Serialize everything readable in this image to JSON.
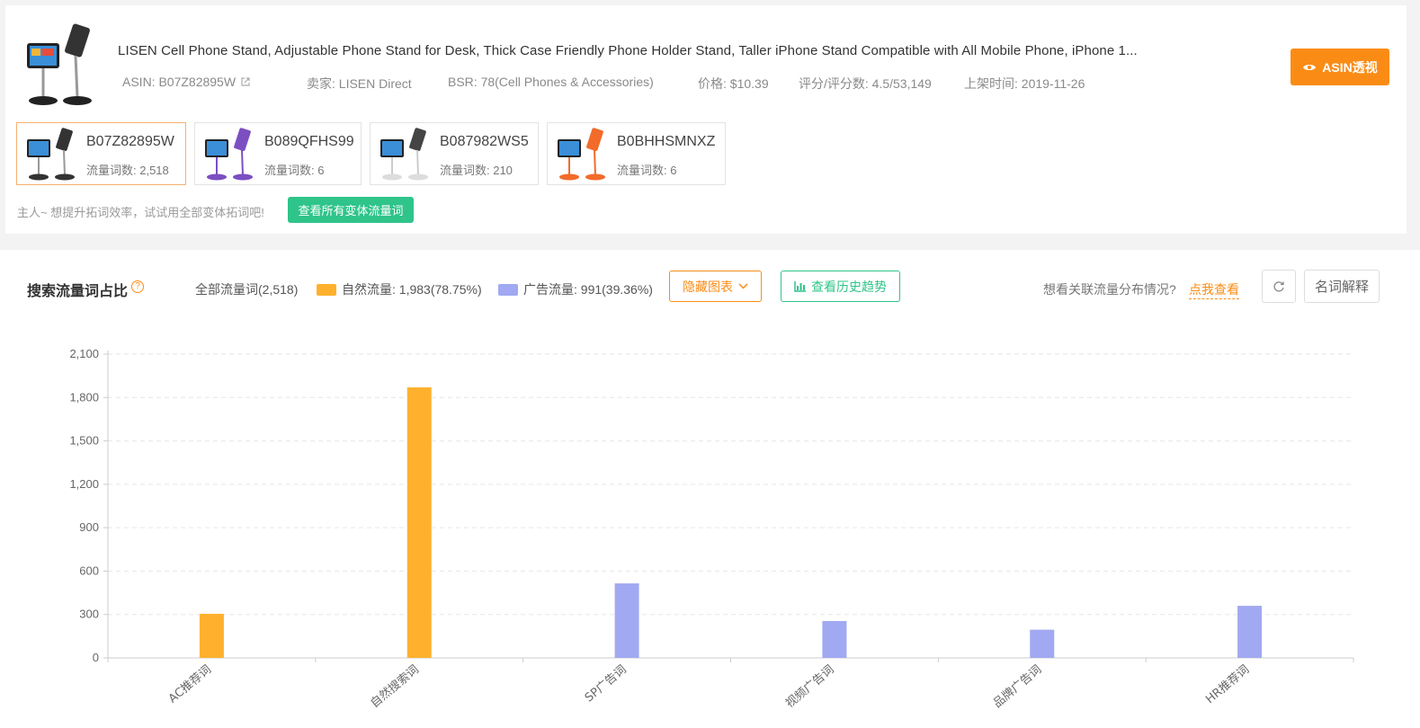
{
  "product": {
    "title": "LISEN Cell Phone Stand, Adjustable Phone Stand for Desk, Thick Case Friendly Phone Holder Stand, Taller iPhone Stand Compatible with All Mobile Phone, iPhone 1...",
    "asin": "ASIN: B07Z82895W",
    "seller": "卖家: LISEN Direct",
    "bsr": "BSR: 78(Cell Phones & Accessories)",
    "price": "价格: $10.39",
    "rating": "评分/评分数: 4.5/53,149",
    "listed": "上架时间: 2019-11-26",
    "asin_button": "ASIN透视"
  },
  "variants": [
    {
      "asin": "B07Z82895W",
      "count": "流量词数: 2,518",
      "color": "#333333"
    },
    {
      "asin": "B089QFHS99",
      "count": "流量词数: 6",
      "color": "#7b4fc2"
    },
    {
      "asin": "B087982WS5",
      "count": "流量词数: 210",
      "color": "#e8e8e8"
    },
    {
      "asin": "B0BHHSMNXZ",
      "count": "流量词数: 6",
      "color": "#f26b2b"
    }
  ],
  "tip": {
    "text": "主人~ 想提升拓词效率，试试用全部变体拓词吧!",
    "button": "查看所有变体流量词"
  },
  "section": {
    "title": "搜索流量词占比",
    "legend_all": "全部流量词(2,518)",
    "legend_organic": "自然流量: 1,983(78.75%)",
    "legend_ads": "广告流量: 991(39.36%)",
    "hide_chart": "隐藏图表",
    "history": "查看历史趋势",
    "related_question": "想看关联流量分布情况?",
    "related_link": "点我查看",
    "terms": "名词解释"
  },
  "colors": {
    "accent": "#fa8c16",
    "green": "#2fc48a",
    "organic": "#ffb12e",
    "ads": "#a1a9f2"
  },
  "chart_data": {
    "type": "bar",
    "categories": [
      "AC推荐词",
      "自然搜索词",
      "SP广告词",
      "视频广告词",
      "品牌广告词",
      "HR推荐词"
    ],
    "values": [
      305,
      1870,
      515,
      255,
      195,
      360
    ],
    "series_type": [
      "organic",
      "organic",
      "ads",
      "ads",
      "ads",
      "ads"
    ],
    "ylim": [
      0,
      2100
    ],
    "yticks": [
      "0",
      "300",
      "600",
      "900",
      "1,200",
      "1,500",
      "1,800",
      "2,100"
    ],
    "grid": true
  }
}
